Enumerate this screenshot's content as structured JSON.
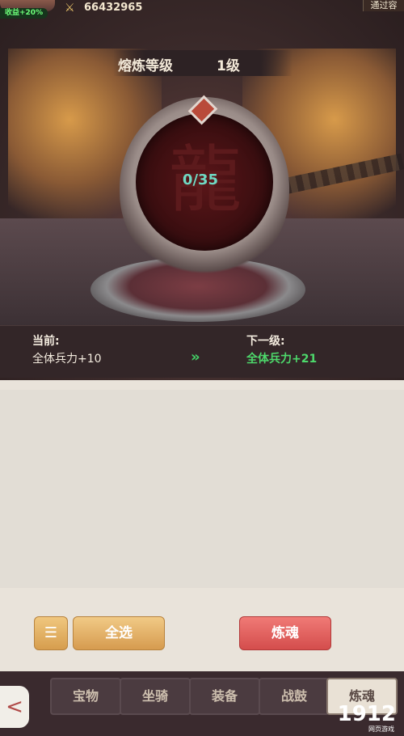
{
  "topbar": {
    "bonus": "收益+20%",
    "power": "66432965",
    "right_text": "通过容"
  },
  "refine": {
    "label": "熔炼等级",
    "level": "1级",
    "progress": "0/35",
    "current_label": "当前:",
    "current_value": "全体兵力+10",
    "next_label": "下一级:",
    "next_value": "全体兵力+21"
  },
  "buttons": {
    "select_all": "全选",
    "refine": "炼魂"
  },
  "tabs": [
    "宝物",
    "坐骑",
    "装备",
    "战鼓",
    "炼魂"
  ],
  "watermark": {
    "text": "1912",
    "sub": "网页游戏"
  }
}
